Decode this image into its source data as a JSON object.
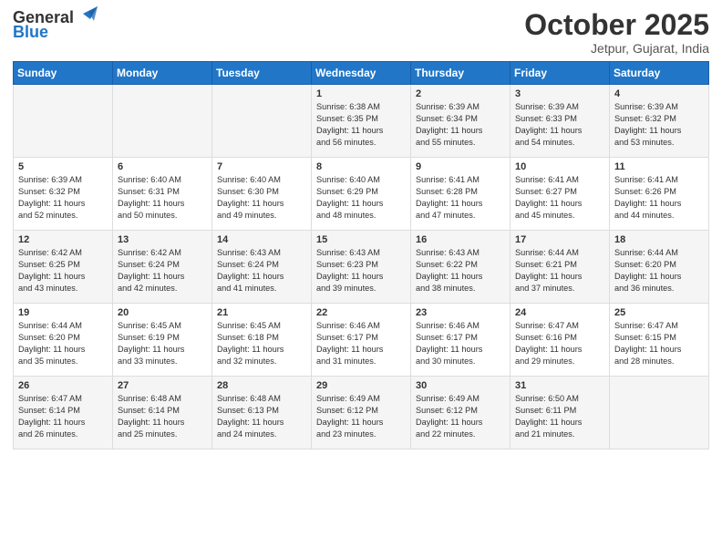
{
  "header": {
    "logo_general": "General",
    "logo_blue": "Blue",
    "month_title": "October 2025",
    "location": "Jetpur, Gujarat, India"
  },
  "days_of_week": [
    "Sunday",
    "Monday",
    "Tuesday",
    "Wednesday",
    "Thursday",
    "Friday",
    "Saturday"
  ],
  "weeks": [
    [
      {
        "day": "",
        "info": ""
      },
      {
        "day": "",
        "info": ""
      },
      {
        "day": "",
        "info": ""
      },
      {
        "day": "1",
        "info": "Sunrise: 6:38 AM\nSunset: 6:35 PM\nDaylight: 11 hours\nand 56 minutes."
      },
      {
        "day": "2",
        "info": "Sunrise: 6:39 AM\nSunset: 6:34 PM\nDaylight: 11 hours\nand 55 minutes."
      },
      {
        "day": "3",
        "info": "Sunrise: 6:39 AM\nSunset: 6:33 PM\nDaylight: 11 hours\nand 54 minutes."
      },
      {
        "day": "4",
        "info": "Sunrise: 6:39 AM\nSunset: 6:32 PM\nDaylight: 11 hours\nand 53 minutes."
      }
    ],
    [
      {
        "day": "5",
        "info": "Sunrise: 6:39 AM\nSunset: 6:32 PM\nDaylight: 11 hours\nand 52 minutes."
      },
      {
        "day": "6",
        "info": "Sunrise: 6:40 AM\nSunset: 6:31 PM\nDaylight: 11 hours\nand 50 minutes."
      },
      {
        "day": "7",
        "info": "Sunrise: 6:40 AM\nSunset: 6:30 PM\nDaylight: 11 hours\nand 49 minutes."
      },
      {
        "day": "8",
        "info": "Sunrise: 6:40 AM\nSunset: 6:29 PM\nDaylight: 11 hours\nand 48 minutes."
      },
      {
        "day": "9",
        "info": "Sunrise: 6:41 AM\nSunset: 6:28 PM\nDaylight: 11 hours\nand 47 minutes."
      },
      {
        "day": "10",
        "info": "Sunrise: 6:41 AM\nSunset: 6:27 PM\nDaylight: 11 hours\nand 45 minutes."
      },
      {
        "day": "11",
        "info": "Sunrise: 6:41 AM\nSunset: 6:26 PM\nDaylight: 11 hours\nand 44 minutes."
      }
    ],
    [
      {
        "day": "12",
        "info": "Sunrise: 6:42 AM\nSunset: 6:25 PM\nDaylight: 11 hours\nand 43 minutes."
      },
      {
        "day": "13",
        "info": "Sunrise: 6:42 AM\nSunset: 6:24 PM\nDaylight: 11 hours\nand 42 minutes."
      },
      {
        "day": "14",
        "info": "Sunrise: 6:43 AM\nSunset: 6:24 PM\nDaylight: 11 hours\nand 41 minutes."
      },
      {
        "day": "15",
        "info": "Sunrise: 6:43 AM\nSunset: 6:23 PM\nDaylight: 11 hours\nand 39 minutes."
      },
      {
        "day": "16",
        "info": "Sunrise: 6:43 AM\nSunset: 6:22 PM\nDaylight: 11 hours\nand 38 minutes."
      },
      {
        "day": "17",
        "info": "Sunrise: 6:44 AM\nSunset: 6:21 PM\nDaylight: 11 hours\nand 37 minutes."
      },
      {
        "day": "18",
        "info": "Sunrise: 6:44 AM\nSunset: 6:20 PM\nDaylight: 11 hours\nand 36 minutes."
      }
    ],
    [
      {
        "day": "19",
        "info": "Sunrise: 6:44 AM\nSunset: 6:20 PM\nDaylight: 11 hours\nand 35 minutes."
      },
      {
        "day": "20",
        "info": "Sunrise: 6:45 AM\nSunset: 6:19 PM\nDaylight: 11 hours\nand 33 minutes."
      },
      {
        "day": "21",
        "info": "Sunrise: 6:45 AM\nSunset: 6:18 PM\nDaylight: 11 hours\nand 32 minutes."
      },
      {
        "day": "22",
        "info": "Sunrise: 6:46 AM\nSunset: 6:17 PM\nDaylight: 11 hours\nand 31 minutes."
      },
      {
        "day": "23",
        "info": "Sunrise: 6:46 AM\nSunset: 6:17 PM\nDaylight: 11 hours\nand 30 minutes."
      },
      {
        "day": "24",
        "info": "Sunrise: 6:47 AM\nSunset: 6:16 PM\nDaylight: 11 hours\nand 29 minutes."
      },
      {
        "day": "25",
        "info": "Sunrise: 6:47 AM\nSunset: 6:15 PM\nDaylight: 11 hours\nand 28 minutes."
      }
    ],
    [
      {
        "day": "26",
        "info": "Sunrise: 6:47 AM\nSunset: 6:14 PM\nDaylight: 11 hours\nand 26 minutes."
      },
      {
        "day": "27",
        "info": "Sunrise: 6:48 AM\nSunset: 6:14 PM\nDaylight: 11 hours\nand 25 minutes."
      },
      {
        "day": "28",
        "info": "Sunrise: 6:48 AM\nSunset: 6:13 PM\nDaylight: 11 hours\nand 24 minutes."
      },
      {
        "day": "29",
        "info": "Sunrise: 6:49 AM\nSunset: 6:12 PM\nDaylight: 11 hours\nand 23 minutes."
      },
      {
        "day": "30",
        "info": "Sunrise: 6:49 AM\nSunset: 6:12 PM\nDaylight: 11 hours\nand 22 minutes."
      },
      {
        "day": "31",
        "info": "Sunrise: 6:50 AM\nSunset: 6:11 PM\nDaylight: 11 hours\nand 21 minutes."
      },
      {
        "day": "",
        "info": ""
      }
    ]
  ]
}
